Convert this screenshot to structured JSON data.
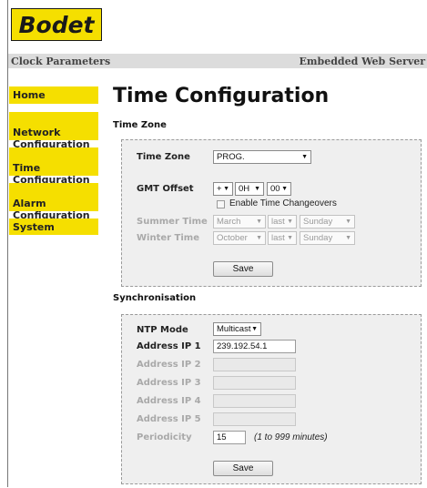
{
  "logo": {
    "text": "Bodet"
  },
  "topbar": {
    "left": "Clock Parameters",
    "right": "Embedded Web Server"
  },
  "nav": [
    {
      "label": "Home"
    },
    {
      "label": "Network\nConfiguration"
    },
    {
      "label": "Time\nConfiguration"
    },
    {
      "label": "Alarm\nConfiguration"
    },
    {
      "label": "System"
    }
  ],
  "page_title": "Time Configuration",
  "time_zone": {
    "section_title": "Time Zone",
    "tz_label": "Time Zone",
    "tz_value": "PROG.",
    "gmt_label": "GMT Offset",
    "gmt_sign": "+",
    "gmt_hours": "0H",
    "gmt_minutes": "00",
    "enable_changeovers_label": "Enable Time Changeovers",
    "summer_label": "Summer Time",
    "summer_month": "March",
    "summer_week": "last",
    "summer_day": "Sunday",
    "winter_label": "Winter Time",
    "winter_month": "October",
    "winter_week": "last",
    "winter_day": "Sunday",
    "save_label": "Save"
  },
  "sync": {
    "section_title": "Synchronisation",
    "ntp_label": "NTP Mode",
    "ntp_value": "Multicast",
    "ip1_label": "Address IP 1",
    "ip1_value": "239.192.54.1",
    "ip2_label": "Address IP 2",
    "ip3_label": "Address IP 3",
    "ip4_label": "Address IP 4",
    "ip5_label": "Address IP 5",
    "periodicity_label": "Periodicity",
    "periodicity_value": "15",
    "periodicity_hint": "(1 to 999 minutes)",
    "save_label": "Save"
  },
  "colors": {
    "brand_yellow": "#f5df00",
    "panel_bg": "#efefef"
  }
}
